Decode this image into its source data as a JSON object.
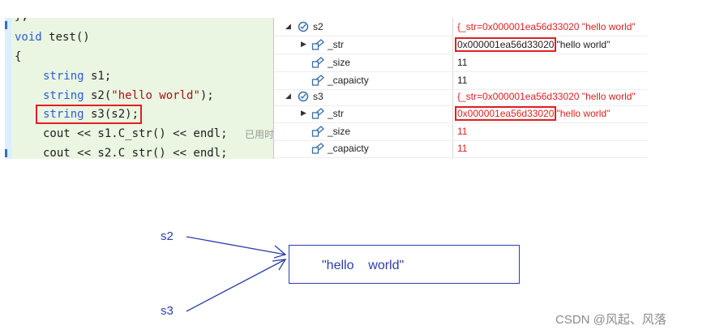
{
  "code": {
    "line_prev": "};",
    "signature_kw": "void",
    "signature_rest": " test()",
    "open_brace": "{",
    "l1_type": "string",
    "l1_rest": " s1;",
    "l2_type": "string",
    "l2_mid": " s2(",
    "l2_str": "\"hello world\"",
    "l2_end": ");",
    "l3_type": "string",
    "l3_rest": " s3(s2);",
    "l4": "cout << s1.C_str() << endl;",
    "l4_hint": "已用时",
    "l5": "cout << s2.C_str() << endl;"
  },
  "watch": {
    "rows": [
      {
        "name": "s2",
        "value": "{_str=0x000001ea56d33020 \"hello world\""
      },
      {
        "name": "_str",
        "addr": "0x000001ea56d33020",
        "text": "\"hello world\""
      },
      {
        "name": "_size",
        "value": "11"
      },
      {
        "name": "_capaicty",
        "value": "11"
      },
      {
        "name": "s3",
        "value": "{_str=0x000001ea56d33020 \"hello world\""
      },
      {
        "name": "_str",
        "addr": "0x000001ea56d33020",
        "text": "\"hello world\""
      },
      {
        "name": "_size",
        "value": "11"
      },
      {
        "name": "_capaicty",
        "value": "11"
      }
    ]
  },
  "diagram": {
    "label_top": "s2",
    "label_bottom": "s3",
    "box_text": "\"hello    world\"",
    "watermark": "CSDN @风起、风落"
  },
  "colors": {
    "accent_red": "#e02020",
    "diagram_blue": "#2c3ea8",
    "keyword_blue": "#2a5fd0",
    "editor_bg": "#eaf5e2"
  }
}
